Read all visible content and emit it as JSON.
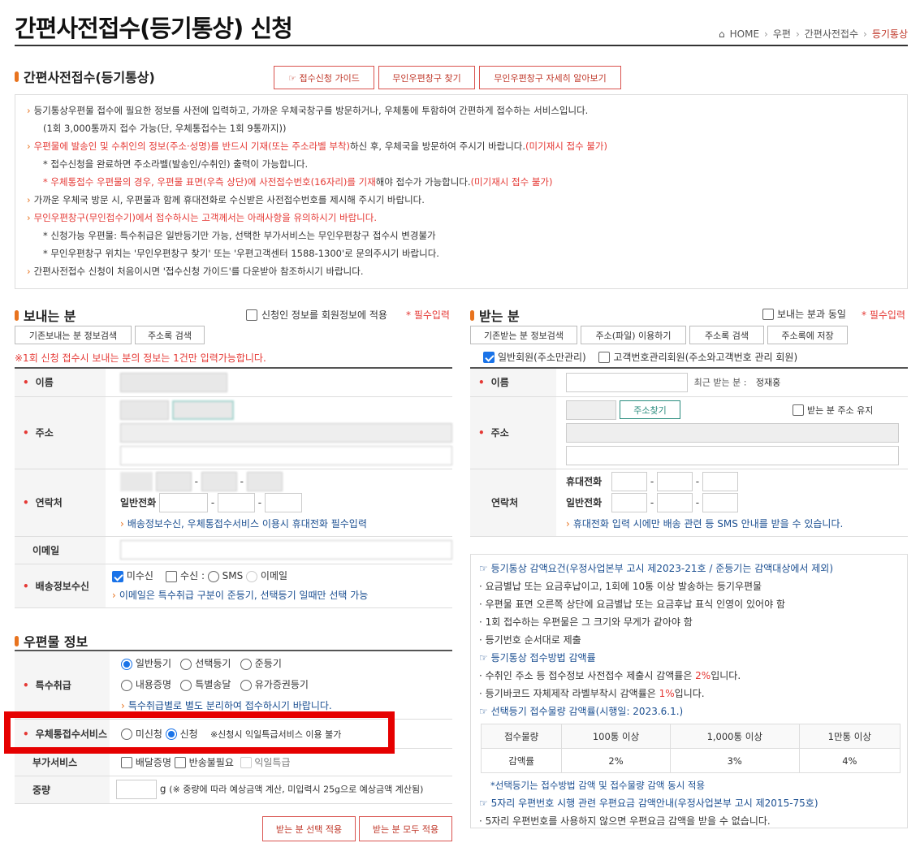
{
  "page": {
    "title": "간편사전접수(등기통상) 신청"
  },
  "breadcrumb": {
    "home": "HOME",
    "items": [
      "우편",
      "간편사전접수"
    ],
    "current": "등기통상"
  },
  "intro": {
    "section_title": "간편사전접수(등기통상)",
    "buttons": {
      "guide": "☞ 접수신청 가이드",
      "find_kiosk": "무인우편창구 찾기",
      "kiosk_detail": "무인우편창구 자세히 알아보기"
    },
    "lines": [
      {
        "t": "bullet",
        "text": "등기통상우편물 접수에 필요한 정보를 사전에 입력하고, 가까운 우체국창구를 방문하거나, 우체통에 투함하여 간편하게 접수하는 서비스입니다."
      },
      {
        "t": "indent",
        "text": "(1회 3,000통까지 접수 가능(단, 우체통접수는 1회 9통까지))"
      },
      {
        "t": "bullet",
        "red": "우편물에 발송인 및 수취인의 정보(주소·성명)를 반드시 기재(또는 주소라벨 부착)",
        "text": "하신 후, 우체국을 방문하여 주시기 바랍니다.",
        "red2": "(미기재시 접수 불가)"
      },
      {
        "t": "star",
        "text": "* 접수신청을 완료하면 주소라벨(발송인/수취인) 출력이 가능합니다."
      },
      {
        "t": "star",
        "red": "* 우체통접수 우편물의 경우, 우편물 표면(우측 상단)에 사전접수번호(16자리)를 기재",
        "text": "해야 접수가 가능합니다.",
        "red2": "(미기재시 접수 불가)"
      },
      {
        "t": "bullet",
        "text": "가까운 우체국 방문 시, 우편물과 함께 휴대전화로 수신받은 사전접수번호를 제시해 주시기 바랍니다."
      },
      {
        "t": "bullet",
        "red": "무인우편창구(무인접수기)에서 접수하시는 고객께서는 아래사항을 유의하시기 바랍니다."
      },
      {
        "t": "star",
        "text": "* 신청가능 우편물: 특수취급은 일반등기만 가능, 선택한 부가서비스는 무인우편창구 접수시 변경불가"
      },
      {
        "t": "star",
        "text": "* 무인우편창구 위치는 '무인우편창구 찾기' 또는 '우편고객센터 1588-1300'로 문의주시기 바랍니다."
      },
      {
        "t": "bullet",
        "text": "간편사전접수 신청이 처음이시면 '접수신청 가이드'를 다운받아 참조하시기 바랍니다."
      }
    ]
  },
  "sender": {
    "section_title": "보내는 분",
    "same_member": "신청인 정보를 회원정보에 적용",
    "required": "* 필수입력",
    "btn_existing": "기존보내는 분 정보검색",
    "btn_addrbook": "주소록 검색",
    "warning": "※1회 신청 접수시 보내는 분의 정보는 1건만 입력가능합니다.",
    "label_name": "이름",
    "label_addr": "주소",
    "label_contact": "연락처",
    "label_email": "이메일",
    "label_notify": "배송정보수신",
    "general_phone": "일반전화",
    "contact_hint": "배송정보수신, 우체통접수서비스 이용시 휴대전화 필수입력",
    "notify": {
      "opt_none": "미수신",
      "opt_recv": "수신 :",
      "opt_sms": "SMS",
      "opt_email": "이메일"
    },
    "notify_hint": "이메일은 특수취급 구분이 준등기, 선택등기 일때만 선택 가능"
  },
  "mail": {
    "section_title": "우편물 정보",
    "label_special": "특수취급",
    "special_opts": [
      "일반등기",
      "선택등기",
      "준등기",
      "내용증명",
      "특별송달",
      "유가증권등기"
    ],
    "special_hint": "특수취급별로 별도 분리하여 접수하시기 바랍니다.",
    "label_postbox": "우체통접수서비스",
    "postbox_opts": [
      "미신청",
      "신청"
    ],
    "postbox_note": "※신청시 익일특급서비스 이용 불가",
    "label_addon": "부가서비스",
    "addon_opts": [
      "배달증명",
      "반송불필요",
      "익일특급"
    ],
    "label_weight": "중량",
    "weight_unit": "g",
    "weight_note": "(※ 중량에 따라 예상금액 계산, 미입력시 25g으로 예상금액 계산됨)",
    "btn_apply_selected": "받는 분 선택 적용",
    "btn_apply_all": "받는 분 모두 적용"
  },
  "receiver": {
    "section_title": "받는 분",
    "same_sender": "보내는 분과 동일",
    "required": "* 필수입력",
    "btn_existing": "기존받는 분 정보검색",
    "btn_file": "주소(파일) 이용하기",
    "btn_addrbook": "주소록 검색",
    "btn_save": "주소록에 저장",
    "member_general": "일반회원(주소만관리)",
    "member_customer": "고객번호관리회원(주소와고객번호 관리 회원)",
    "label_name": "이름",
    "label_addr": "주소",
    "label_contact": "연락처",
    "recent_label": "최근 받는 분 :",
    "recent_name": "정재홍",
    "btn_find_addr": "주소찾기",
    "keep_addr": "받는 분 주소 유지",
    "mobile": "휴대전화",
    "general_phone": "일반전화",
    "contact_hint": "휴대전화 입력 시에만 배송 관련 등 SMS 안내를 받을 수 있습니다."
  },
  "notes": {
    "h1": "☞ 등기통상 감액요건(우정사업본부 고시 제2023-21호 / 준등기는 감액대상에서 제외)",
    "l1": "· 요금별납 또는 요금후납이고, 1회에 10통 이상 발송하는 등기우편물",
    "l2": "· 우편물 표면 오른쪽 상단에 요금별납 또는 요금후납 표식 인영이 있어야 함",
    "l3": "· 1회 접수하는 우편물은 그 크기와 무게가 같아야 함",
    "l4": "· 등기번호 순서대로 제출",
    "h2": "☞ 등기통상 접수방법 감액률",
    "l5a": "· 수취인 주소 등 접수정보 사전접수 제출시 감액률은 ",
    "l5r": "2%",
    "l5b": "입니다.",
    "l6a": "· 등기바코드 자체제작 라벨부착시 감액률은 ",
    "l6r": "1%",
    "l6b": "입니다.",
    "h3": "☞ 선택등기 접수물량 감액률(시행일: 2023.6.1.)",
    "table_head": [
      "접수물량",
      "100통 이상",
      "1,000통 이상",
      "1만통 이상"
    ],
    "table_row": [
      "감액률",
      "2%",
      "3%",
      "4%"
    ],
    "l7": "*선택등기는 접수방법 감액 및 접수물량 감액 동시 적용",
    "h4": "☞ 5자리 우편번호 시행 관련 우편요금 감액안내(우정사업본부 고시 제2015-75호)",
    "l8": "· 5자리 우편번호를 사용하지 않으면 우편요금 감액을 받을 수 없습니다."
  },
  "colors": {
    "accent_orange": "#e8731e",
    "red": "#e53935",
    "highlight_box": "#e60000",
    "link_blue": "#1b4f91"
  }
}
